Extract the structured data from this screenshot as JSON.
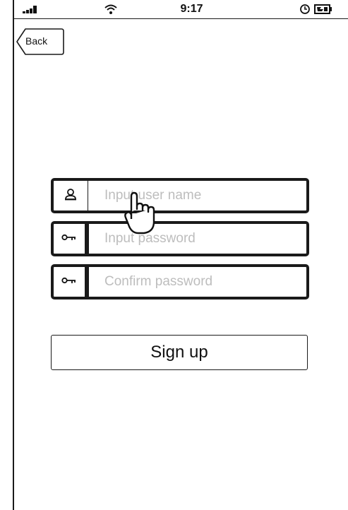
{
  "status_bar": {
    "time": "9:17",
    "icons": [
      "signal-icon",
      "wifi-icon",
      "alarm-icon",
      "battery-icon"
    ]
  },
  "nav": {
    "back_label": "Back"
  },
  "form": {
    "username": {
      "placeholder": "Input user name",
      "value": "",
      "icon": "user-icon"
    },
    "password": {
      "placeholder": "Input password",
      "value": "",
      "icon": "key-icon"
    },
    "confirm_password": {
      "placeholder": "Confirm password",
      "value": "",
      "icon": "key-icon"
    },
    "signup_label": "Sign up"
  },
  "cursor": {
    "icon": "hand-pointer-icon"
  }
}
